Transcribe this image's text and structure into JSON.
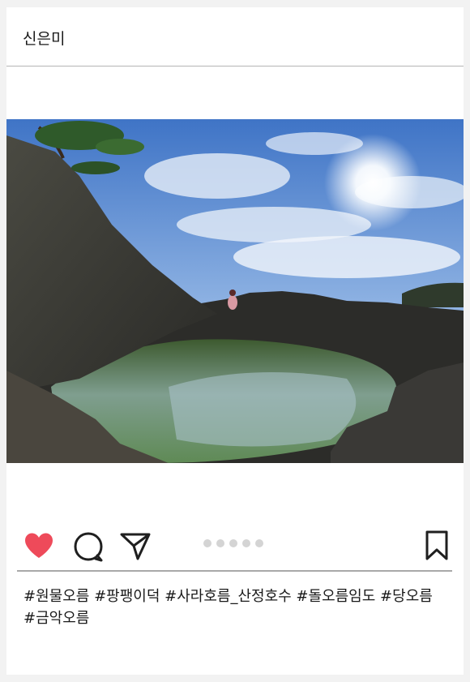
{
  "post": {
    "username": "신은미",
    "hashtags": [
      "#원물오름",
      "#팡팽이덕",
      "#사라호름_산정호수",
      "#돌오름임도",
      "#당오름",
      "#금악오름"
    ],
    "carousel": {
      "total": 5,
      "current": 1
    },
    "liked": true
  },
  "icons": {
    "like": "heart-icon",
    "comment": "comment-bubble-icon",
    "share": "paper-plane-icon",
    "save": "bookmark-icon"
  },
  "colors": {
    "like_active": "#ee4a5a",
    "icon_stroke": "#1f1f1f",
    "dot_inactive": "#d4d4d4",
    "divider": "#a9a9a9"
  }
}
